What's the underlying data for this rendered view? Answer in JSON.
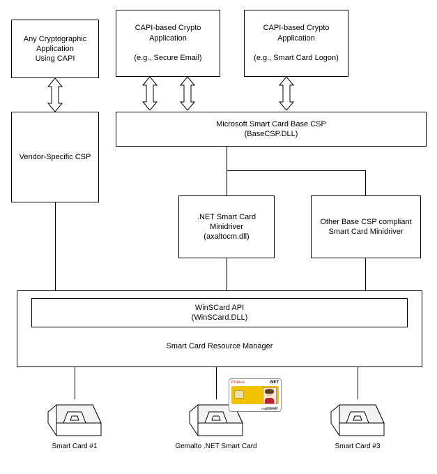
{
  "boxes": {
    "capi_app": "Any Cryptographic\nApplication\nUsing CAPI",
    "capi_email": "CAPI-based Crypto\nApplication\n\n(e.g., Secure Email)",
    "capi_logon": "CAPI-based Crypto\nApplication\n\n(e.g., Smart Card Logon)",
    "vendor_csp": "Vendor-Specific CSP",
    "base_csp": "Microsoft Smart Card Base CSP\n(BaseCSP.DLL)",
    "net_minidriver": ".NET Smart Card\nMinidriver\n(axaltocm.dll)",
    "other_minidriver": "Other Base CSP compliant\nSmart Card Minidriver",
    "winscard_api": "WinSCard API\n(WinSCard.DLL)",
    "resource_manager": "Smart Card Resource Manager"
  },
  "captions": {
    "reader1": "Smart Card #1",
    "reader2": "Gemalto .NET Smart Card",
    "reader3": "Smart Card #3"
  },
  "id_card": {
    "brand": "Prativa",
    "tech": ".NET",
    "name": "Patty James",
    "vendor": "gemalto"
  }
}
